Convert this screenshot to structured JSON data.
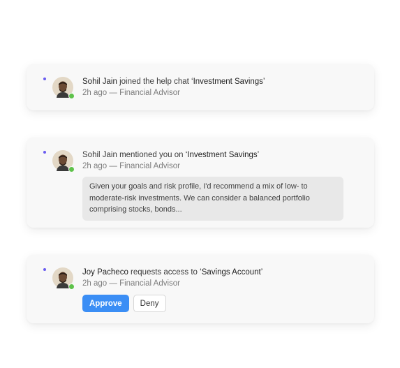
{
  "colors": {
    "unread": "#6a5cf0",
    "online": "#5ec24a",
    "primary": "#3b8ef5"
  },
  "notifications": [
    {
      "actor": "Sohil Jain",
      "action": " joined the help chat ",
      "target": "‘Investment Savings’",
      "time": "2h ago",
      "separator": " — ",
      "role": "Financial Advisor"
    },
    {
      "actor": "Sohil Jain",
      "action": " mentioned you on ",
      "target": "‘Investment Savings’",
      "time": "2h ago",
      "separator": " — ",
      "role": "Financial Advisor",
      "message": "Given your goals and risk profile, I'd recommend a mix of low- to moderate-risk investments. We can consider a balanced portfolio comprising stocks, bonds..."
    },
    {
      "actor": "Joy Pacheco",
      "action": " requests access to ",
      "target": "‘Savings Account’",
      "time": "2h ago",
      "separator": " — ",
      "role": "Financial Advisor",
      "approve_label": "Approve",
      "deny_label": "Deny"
    }
  ]
}
